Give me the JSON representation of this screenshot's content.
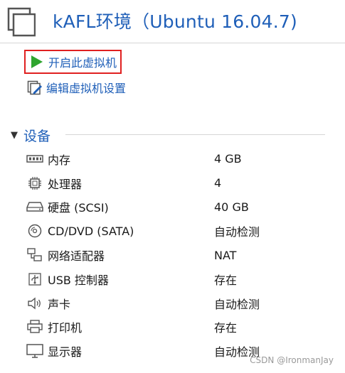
{
  "header": {
    "title": "kAFL环境（Ubuntu 16.04.7)",
    "icon": "vm-window-icon",
    "title_color": "#1f5fb8"
  },
  "actions": [
    {
      "label": "开启此虚拟机",
      "icon": "play-icon",
      "highlighted": true,
      "highlight_color": "#e02020"
    },
    {
      "label": "编辑虚拟机设置",
      "icon": "edit-settings-icon"
    }
  ],
  "devices_section": {
    "title": "设备",
    "items": [
      {
        "name": "内存",
        "value": "4 GB",
        "icon": "memory-icon"
      },
      {
        "name": "处理器",
        "value": "4",
        "icon": "cpu-icon"
      },
      {
        "name": "硬盘 (SCSI)",
        "value": "40 GB",
        "icon": "hard-disk-icon"
      },
      {
        "name": "CD/DVD (SATA)",
        "value": "自动检测",
        "icon": "cd-dvd-icon"
      },
      {
        "name": "网络适配器",
        "value": "NAT",
        "icon": "network-adapter-icon"
      },
      {
        "name": "USB 控制器",
        "value": "存在",
        "icon": "usb-icon"
      },
      {
        "name": "声卡",
        "value": "自动检测",
        "icon": "sound-card-icon"
      },
      {
        "name": "打印机",
        "value": "存在",
        "icon": "printer-icon"
      },
      {
        "name": "显示器",
        "value": "自动检测",
        "icon": "display-icon"
      }
    ]
  },
  "watermark": "CSDN @IronmanJay"
}
